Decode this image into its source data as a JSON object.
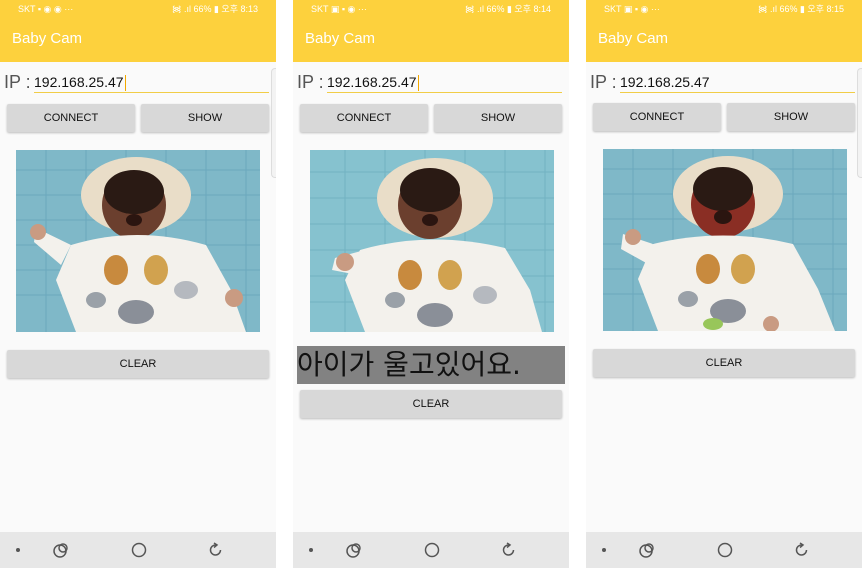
{
  "screens": [
    {
      "status": {
        "left": "SKT ▪ ◉ ◉ ···",
        "right": "᯼ .ıl 66% ▮ 오후 8:13"
      },
      "app_title": "Baby Cam",
      "ip_label": "IP :",
      "ip_value": "192.168.25.47",
      "connect_label": "CONNECT",
      "show_label": "SHOW",
      "clear_label": "CLEAR"
    },
    {
      "status": {
        "left": "SKT ▣ ▪ ◉ ···",
        "right": "᯼ .ıl 66% ▮ 오후 8:14"
      },
      "app_title": "Baby Cam",
      "ip_label": "IP :",
      "ip_value": "192.168.25.47",
      "connect_label": "CONNECT",
      "show_label": "SHOW",
      "message": "아이가 울고있어요.",
      "clear_label": "CLEAR"
    },
    {
      "status": {
        "left": "SKT ▣ ▪ ◉ ···",
        "right": "᯼ .ıl 66% ▮ 오후 8:15"
      },
      "app_title": "Baby Cam",
      "ip_label": "IP :",
      "ip_value": "192.168.25.47",
      "connect_label": "CONNECT",
      "show_label": "SHOW",
      "clear_label": "CLEAR"
    }
  ],
  "colors": {
    "appbar": "#fdd13d",
    "button": "#d8d8d8",
    "message_bg": "#828282",
    "navbar": "#e7e7e7"
  },
  "icons": [
    "nav-dot-icon",
    "recent-apps-icon",
    "home-icon",
    "back-icon"
  ]
}
